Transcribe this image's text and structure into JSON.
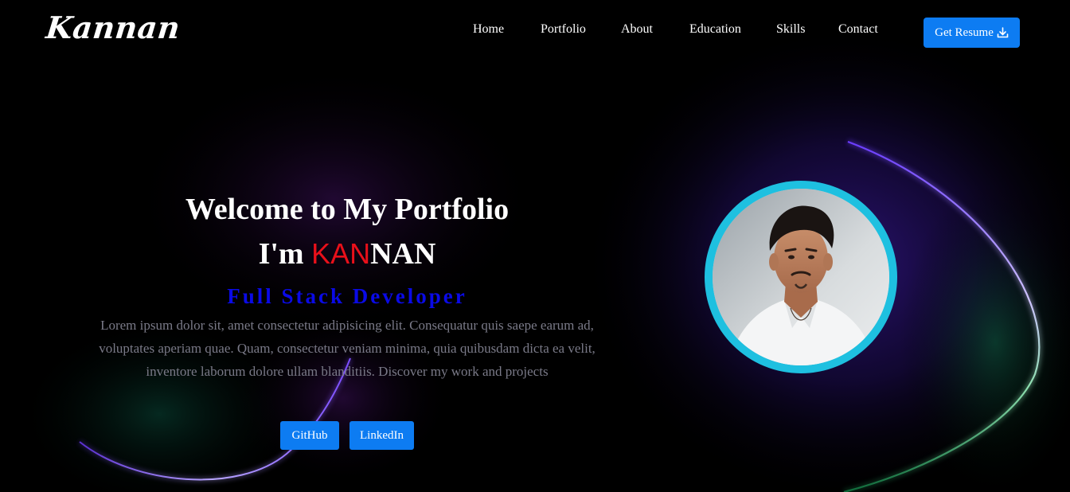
{
  "brand": {
    "logo_text": "Kannan"
  },
  "nav": {
    "items": [
      {
        "label": "Home"
      },
      {
        "label": "Portfolio"
      },
      {
        "label": "About"
      },
      {
        "label": "Education"
      },
      {
        "label": "Skills"
      },
      {
        "label": "Contact"
      }
    ],
    "resume_button": {
      "label": "Get Resume",
      "icon": "download-icon"
    }
  },
  "hero": {
    "title": "Welcome to My Portfolio",
    "name_prefix": "I'm ",
    "name_highlight": "KAN",
    "name_rest": "NAN",
    "role": "Full Stack Developer",
    "description": "Lorem ipsum dolor sit, amet consectetur adipisicing elit. Consequatur quis saepe earum ad, voluptates aperiam quae. Quam, consectetur veniam minima, quia quibusdam dicta ea velit, inventore laborum dolore ullam blanditiis. Discover my work and projects",
    "buttons": [
      {
        "label": "GitHub"
      },
      {
        "label": "LinkedIn"
      }
    ]
  },
  "avatar": {
    "icon": "profile-photo"
  },
  "colors": {
    "background": "#000000",
    "accent": "#0d7cf2",
    "highlight_red": "#e8101a",
    "role_blue": "#0a0ae6",
    "ring_cyan": "#1ec0e0",
    "glow_purple": "#5b2bd6",
    "glow_green": "#1fa85a"
  }
}
